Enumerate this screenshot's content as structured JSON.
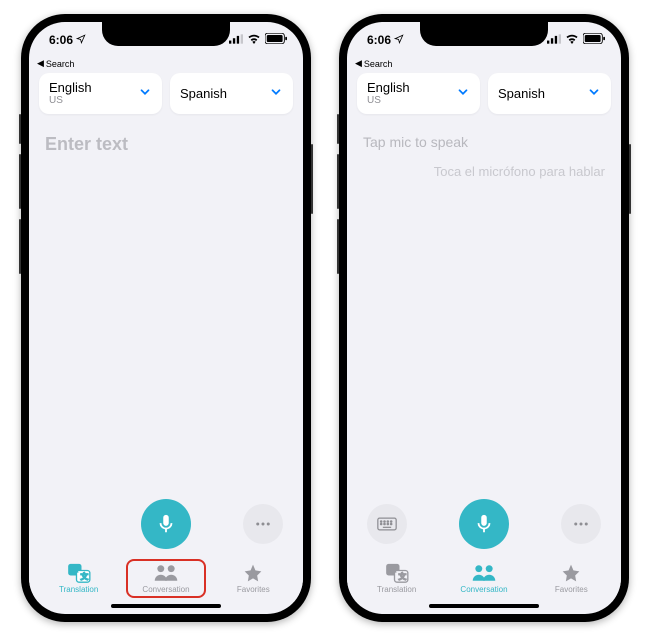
{
  "status": {
    "time": "6:06",
    "back_label": "Search"
  },
  "languages": {
    "from": {
      "name": "English",
      "region": "US"
    },
    "to": {
      "name": "Spanish",
      "region": ""
    }
  },
  "phone1": {
    "placeholder": "Enter text"
  },
  "phone2": {
    "prompt_source": "Tap mic to speak",
    "prompt_target": "Toca el micrófono para hablar"
  },
  "tabs": {
    "translation": "Translation",
    "conversation": "Conversation",
    "favorites": "Favorites"
  },
  "colors": {
    "accent": "#34b7c6",
    "ios_blue": "#007aff",
    "highlight": "#d93025"
  }
}
